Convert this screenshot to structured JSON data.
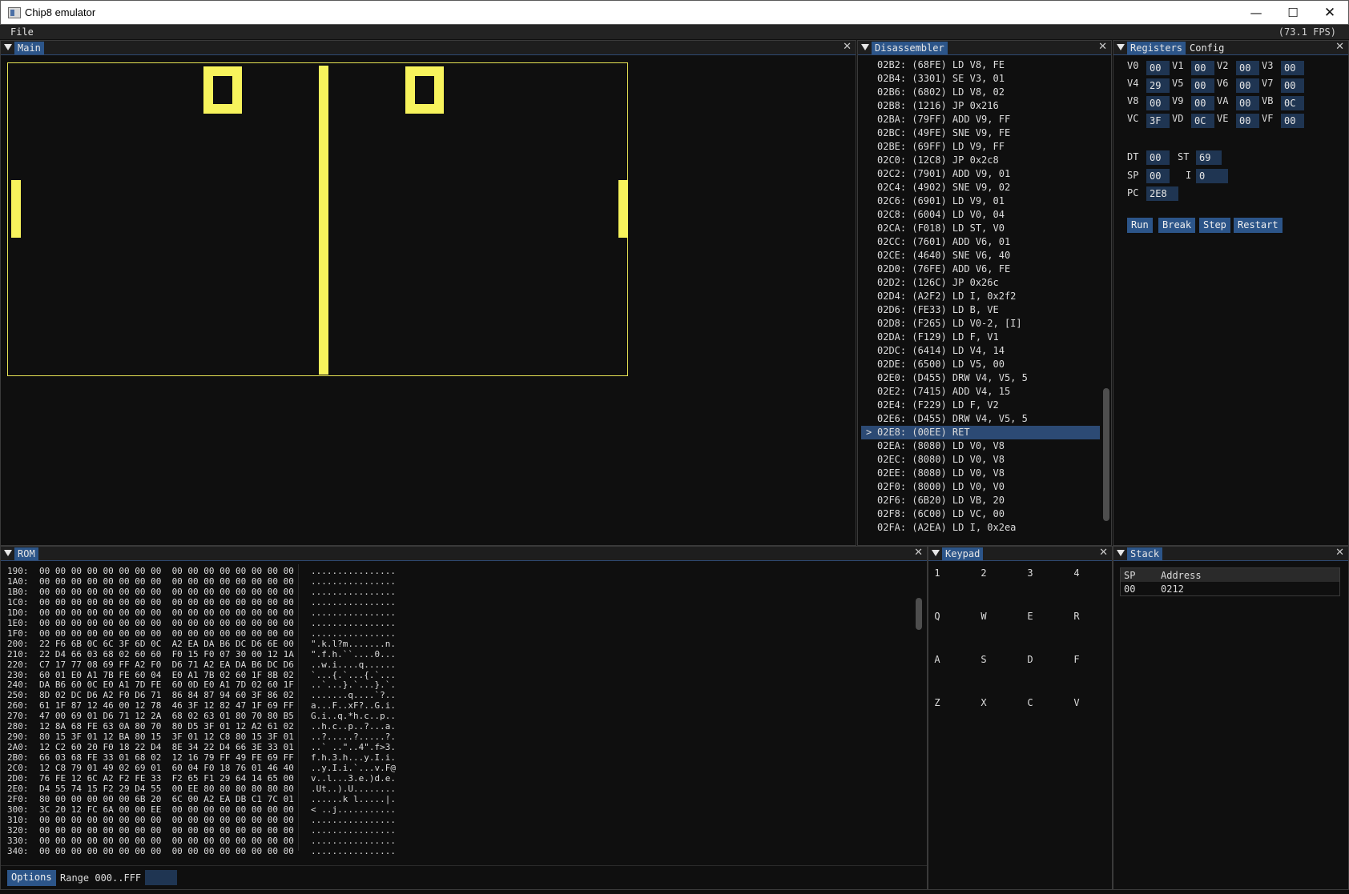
{
  "window": {
    "title": "Chip8 emulator",
    "min": "—",
    "max": "☐",
    "close": "✕"
  },
  "menu": {
    "file": "File",
    "fps": "(73.1 FPS)"
  },
  "main": {
    "tab": "Main"
  },
  "disassembler": {
    "tab": "Disassembler",
    "lines": [
      "02B2: (68FE) LD V8, FE",
      "02B4: (3301) SE V3, 01",
      "02B6: (6802) LD V8, 02",
      "02B8: (1216) JP 0x216",
      "02BA: (79FF) ADD V9, FF",
      "02BC: (49FE) SNE V9, FE",
      "02BE: (69FF) LD V9, FF",
      "02C0: (12C8) JP 0x2c8",
      "02C2: (7901) ADD V9, 01",
      "02C4: (4902) SNE V9, 02",
      "02C6: (6901) LD V9, 01",
      "02C8: (6004) LD V0, 04",
      "02CA: (F018) LD ST, V0",
      "02CC: (7601) ADD V6, 01",
      "02CE: (4640) SNE V6, 40",
      "02D0: (76FE) ADD V6, FE",
      "02D2: (126C) JP 0x26c",
      "02D4: (A2F2) LD I, 0x2f2",
      "02D6: (FE33) LD B, VE",
      "02D8: (F265) LD V0-2, [I]",
      "02DA: (F129) LD F, V1",
      "02DC: (6414) LD V4, 14",
      "02DE: (6500) LD V5, 00",
      "02E0: (D455) DRW V4, V5, 5",
      "02E2: (7415) ADD V4, 15",
      "02E4: (F229) LD F, V2",
      "02E6: (D455) DRW V4, V5, 5",
      "02E8: (00EE) RET",
      "02EA: (8080) LD V0, V8",
      "02EC: (8080) LD V0, V8",
      "02EE: (8080) LD V0, V8",
      "02F0: (8000) LD V0, V0",
      "02F6: (6B20) LD VB, 20",
      "02F8: (6C00) LD VC, 00",
      "02FA: (A2EA) LD I, 0x2ea"
    ],
    "current_marker": ">"
  },
  "registers": {
    "tabs": [
      "Registers",
      "Config"
    ],
    "v": [
      {
        "name": "V0",
        "value": "00"
      },
      {
        "name": "V1",
        "value": "00"
      },
      {
        "name": "V2",
        "value": "00"
      },
      {
        "name": "V3",
        "value": "00"
      },
      {
        "name": "V4",
        "value": "29"
      },
      {
        "name": "V5",
        "value": "00"
      },
      {
        "name": "V6",
        "value": "00"
      },
      {
        "name": "V7",
        "value": "00"
      },
      {
        "name": "V8",
        "value": "00"
      },
      {
        "name": "V9",
        "value": "00"
      },
      {
        "name": "VA",
        "value": "00"
      },
      {
        "name": "VB",
        "value": "0C"
      },
      {
        "name": "VC",
        "value": "3F"
      },
      {
        "name": "VD",
        "value": "0C"
      },
      {
        "name": "VE",
        "value": "00"
      },
      {
        "name": "VF",
        "value": "00"
      }
    ],
    "dt": {
      "label": "DT",
      "value": "00"
    },
    "st": {
      "label": "ST",
      "value": "69"
    },
    "sp": {
      "label": "SP",
      "value": "00"
    },
    "i": {
      "label": "I",
      "value": "0"
    },
    "pc": {
      "label": "PC",
      "value": "2E8"
    },
    "buttons": {
      "run": "Run",
      "break": "Break",
      "step": "Step",
      "restart": "Restart"
    }
  },
  "rom": {
    "tab": "ROM",
    "rows": [
      {
        "addr": "190:",
        "bytes": "00 00 00 00 00 00 00 00  00 00 00 00 00 00 00 00",
        "ascii": "................"
      },
      {
        "addr": "1A0:",
        "bytes": "00 00 00 00 00 00 00 00  00 00 00 00 00 00 00 00",
        "ascii": "................"
      },
      {
        "addr": "1B0:",
        "bytes": "00 00 00 00 00 00 00 00  00 00 00 00 00 00 00 00",
        "ascii": "................"
      },
      {
        "addr": "1C0:",
        "bytes": "00 00 00 00 00 00 00 00  00 00 00 00 00 00 00 00",
        "ascii": "................"
      },
      {
        "addr": "1D0:",
        "bytes": "00 00 00 00 00 00 00 00  00 00 00 00 00 00 00 00",
        "ascii": "................"
      },
      {
        "addr": "1E0:",
        "bytes": "00 00 00 00 00 00 00 00  00 00 00 00 00 00 00 00",
        "ascii": "................"
      },
      {
        "addr": "1F0:",
        "bytes": "00 00 00 00 00 00 00 00  00 00 00 00 00 00 00 00",
        "ascii": "................"
      },
      {
        "addr": "200:",
        "bytes": "22 F6 6B 0C 6C 3F 6D 0C  A2 EA DA B6 DC D6 6E 00",
        "ascii": "\".k.l?m.......n."
      },
      {
        "addr": "210:",
        "bytes": "22 D4 66 03 68 02 60 60  F0 15 F0 07 30 00 12 1A",
        "ascii": "\".f.h.``....0..."
      },
      {
        "addr": "220:",
        "bytes": "C7 17 77 08 69 FF A2 F0  D6 71 A2 EA DA B6 DC D6",
        "ascii": "..w.i....q......"
      },
      {
        "addr": "230:",
        "bytes": "60 01 E0 A1 7B FE 60 04  E0 A1 7B 02 60 1F 8B 02",
        "ascii": "`...{.`...{.`..."
      },
      {
        "addr": "240:",
        "bytes": "DA B6 60 0C E0 A1 7D FE  60 0D E0 A1 7D 02 60 1F",
        "ascii": "..`...}.`...}.`."
      },
      {
        "addr": "250:",
        "bytes": "8D 02 DC D6 A2 F0 D6 71  86 84 87 94 60 3F 86 02",
        "ascii": ".......q....`?.."
      },
      {
        "addr": "260:",
        "bytes": "61 1F 87 12 46 00 12 78  46 3F 12 82 47 1F 69 FF",
        "ascii": "a...F..xF?..G.i."
      },
      {
        "addr": "270:",
        "bytes": "47 00 69 01 D6 71 12 2A  68 02 63 01 80 70 80 B5",
        "ascii": "G.i..q.*h.c..p.."
      },
      {
        "addr": "280:",
        "bytes": "12 8A 68 FE 63 0A 80 70  80 D5 3F 01 12 A2 61 02",
        "ascii": "..h.c..p..?...a."
      },
      {
        "addr": "290:",
        "bytes": "80 15 3F 01 12 BA 80 15  3F 01 12 C8 80 15 3F 01",
        "ascii": "..?.....?.....?."
      },
      {
        "addr": "2A0:",
        "bytes": "12 C2 60 20 F0 18 22 D4  8E 34 22 D4 66 3E 33 01",
        "ascii": "..` ..\"..4\".f>3."
      },
      {
        "addr": "2B0:",
        "bytes": "66 03 68 FE 33 01 68 02  12 16 79 FF 49 FE 69 FF",
        "ascii": "f.h.3.h...y.I.i."
      },
      {
        "addr": "2C0:",
        "bytes": "12 C8 79 01 49 02 69 01  60 04 F0 18 76 01 46 40",
        "ascii": "..y.I.i.`...v.F@"
      },
      {
        "addr": "2D0:",
        "bytes": "76 FE 12 6C A2 F2 FE 33  F2 65 F1 29 64 14 65 00",
        "ascii": "v..l...3.e.)d.e."
      },
      {
        "addr": "2E0:",
        "bytes": "D4 55 74 15 F2 29 D4 55  00 EE 80 80 80 80 80 80",
        "ascii": ".Ut..).U........"
      },
      {
        "addr": "2F0:",
        "bytes": "80 00 00 00 00 00 6B 20  6C 00 A2 EA DB C1 7C 01",
        "ascii": "......k l.....|."
      },
      {
        "addr": "300:",
        "bytes": "3C 20 12 FC 6A 00 00 EE  00 00 00 00 00 00 00 00",
        "ascii": "< ..j..........."
      },
      {
        "addr": "310:",
        "bytes": "00 00 00 00 00 00 00 00  00 00 00 00 00 00 00 00",
        "ascii": "................"
      },
      {
        "addr": "320:",
        "bytes": "00 00 00 00 00 00 00 00  00 00 00 00 00 00 00 00",
        "ascii": "................"
      },
      {
        "addr": "330:",
        "bytes": "00 00 00 00 00 00 00 00  00 00 00 00 00 00 00 00",
        "ascii": "................"
      },
      {
        "addr": "340:",
        "bytes": "00 00 00 00 00 00 00 00  00 00 00 00 00 00 00 00",
        "ascii": "................"
      }
    ],
    "options_label": "Options",
    "range_label": "Range 000..FFF"
  },
  "keypad": {
    "tab": "Keypad",
    "keys": [
      "1",
      "2",
      "3",
      "4",
      "Q",
      "W",
      "E",
      "R",
      "A",
      "S",
      "D",
      "F",
      "Z",
      "X",
      "C",
      "V"
    ]
  },
  "stack": {
    "tab": "Stack",
    "columns": [
      "SP",
      "Address"
    ],
    "rows": [
      {
        "sp": "00",
        "address": "0212"
      }
    ]
  },
  "colors": {
    "pixel": "#f7f35c",
    "accent": "#2c5589",
    "field": "#1f3552"
  }
}
